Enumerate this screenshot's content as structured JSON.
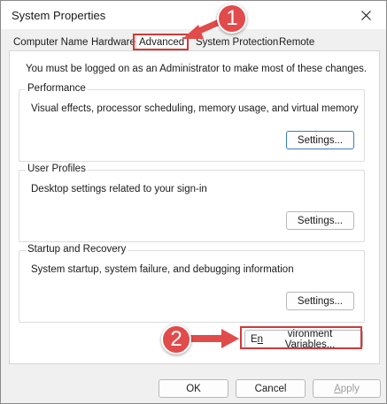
{
  "window": {
    "title": "System Properties"
  },
  "tabs": [
    "Computer Name",
    "Hardware",
    "Advanced",
    "System Protection",
    "Remote"
  ],
  "notice": "You must be logged on as an Administrator to make most of these changes.",
  "performance": {
    "label": "Performance",
    "desc": "Visual effects, processor scheduling, memory usage, and virtual memory",
    "button": "Settings..."
  },
  "profiles": {
    "label": "User Profiles",
    "desc": "Desktop settings related to your sign-in",
    "button": "Settings..."
  },
  "startup": {
    "label": "Startup and Recovery",
    "desc": "System startup, system failure, and debugging information",
    "button": "Settings..."
  },
  "env_button": {
    "before": "E",
    "underlined": "n",
    "after": "vironment Variables..."
  },
  "footer": {
    "ok": "OK",
    "cancel": "Cancel",
    "apply_underlined": "A",
    "apply_rest": "pply"
  },
  "annotations": {
    "step1": "1",
    "step2": "2",
    "color": "#e14b4b"
  },
  "icons": {
    "close": "close-icon"
  }
}
